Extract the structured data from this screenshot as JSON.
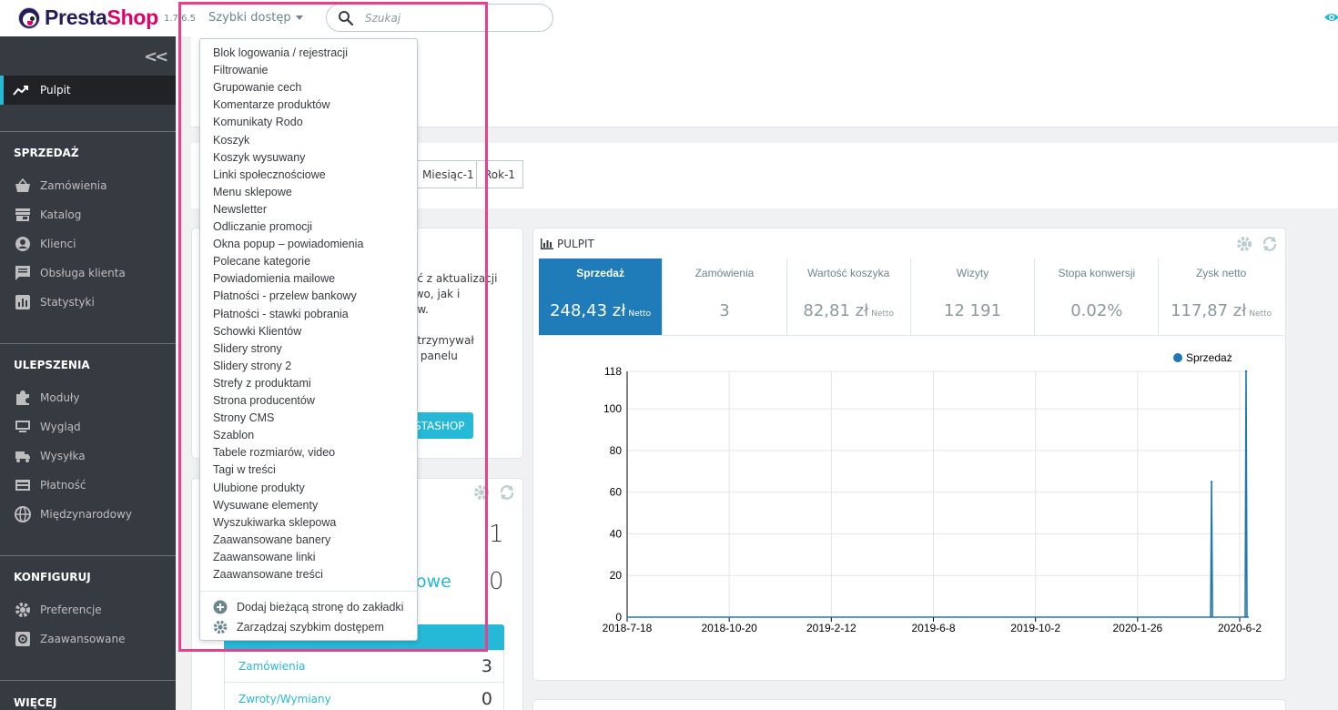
{
  "header": {
    "logo_presta": "Presta",
    "logo_shop": "Shop",
    "version": "1.7.6.5",
    "quick_access_label": "Szybki dostęp",
    "search_placeholder": "Szukaj"
  },
  "sidebar": {
    "collapse_label": "<<",
    "dashboard_label": "Pulpit",
    "sections": [
      {
        "title": "SPRZEDAŻ",
        "items": [
          {
            "label": "Zamówienia",
            "icon": "shopping-basket-icon"
          },
          {
            "label": "Katalog",
            "icon": "store-icon"
          },
          {
            "label": "Klienci",
            "icon": "user-circle-icon"
          },
          {
            "label": "Obsługa klienta",
            "icon": "chat-icon"
          },
          {
            "label": "Statystyki",
            "icon": "bar-chart-icon"
          }
        ]
      },
      {
        "title": "ULEPSZENIA",
        "items": [
          {
            "label": "Moduły",
            "icon": "puzzle-icon"
          },
          {
            "label": "Wygląd",
            "icon": "monitor-icon"
          },
          {
            "label": "Wysyłka",
            "icon": "truck-icon"
          },
          {
            "label": "Płatność",
            "icon": "payment-icon"
          },
          {
            "label": "Międzynarodowy",
            "icon": "globe-icon"
          }
        ]
      },
      {
        "title": "KONFIGURUJ",
        "items": [
          {
            "label": "Preferencje",
            "icon": "settings-icon"
          },
          {
            "label": "Zaawansowane",
            "icon": "settings-box-icon"
          }
        ]
      },
      {
        "title": "WIĘCEJ",
        "items": []
      }
    ]
  },
  "period": {
    "month_label": "Miesiąc-1",
    "year_label": "Rok-1"
  },
  "left_panel": {
    "text_lines": [
      "ać z aktualizacji",
      "two, jak i",
      "ów.",
      "",
      "otrzymywał",
      "y panelu"
    ],
    "button_label": "STASHOP"
  },
  "activity_panel": {
    "big_num_1": "1",
    "big_num_2": "0",
    "blue_text": "owe",
    "rows": [
      {
        "label": "Zamówienia",
        "value": "3"
      },
      {
        "label": "Zwroty/Wymiany",
        "value": "0"
      }
    ]
  },
  "dashboard": {
    "title": "PULPIT",
    "kpis": [
      {
        "label": "Sprzedaż",
        "value": "248,43 zł",
        "suffix": "Netto",
        "active": true
      },
      {
        "label": "Zamówienia",
        "value": "3",
        "suffix": ""
      },
      {
        "label": "Wartość koszyka",
        "value": "82,81 zł",
        "suffix": "Netto"
      },
      {
        "label": "Wizyty",
        "value": "12 191",
        "suffix": ""
      },
      {
        "label": "Stopa konwersji",
        "value": "0.02%",
        "suffix": ""
      },
      {
        "label": "Zysk netto",
        "value": "117,87 zł",
        "suffix": "Netto"
      }
    ]
  },
  "chart_data": {
    "type": "line",
    "title": "",
    "xlabel": "",
    "ylabel": "",
    "x_tick_labels": [
      "2018-7-18",
      "2018-10-20",
      "2019-2-12",
      "2019-6-8",
      "2019-10-2",
      "2020-1-26",
      "2020-6-2"
    ],
    "y_ticks": [
      0,
      20,
      40,
      60,
      80,
      100,
      118
    ],
    "ylim": [
      0,
      118
    ],
    "xlim": [
      "2018-07-18",
      "2020-06-02"
    ],
    "grid": true,
    "legend_position": "top-right",
    "series": [
      {
        "name": "Sprzedaż",
        "color": "#1f77b4",
        "points": [
          {
            "x": "2018-07-18",
            "y": 0
          },
          {
            "x": "2020-04-21",
            "y": 0
          },
          {
            "x": "2020-04-22",
            "y": 65
          },
          {
            "x": "2020-04-23",
            "y": 0
          },
          {
            "x": "2020-05-29",
            "y": 0
          },
          {
            "x": "2020-05-30",
            "y": 118
          },
          {
            "x": "2020-05-31",
            "y": 0
          },
          {
            "x": "2020-06-02",
            "y": 0
          }
        ]
      }
    ]
  },
  "quick_access_menu": {
    "items": [
      "Blok logowania / rejestracji",
      "Filtrowanie",
      "Grupowanie cech",
      "Komentarze produktów",
      "Komunikaty Rodo",
      "Koszyk",
      "Koszyk wysuwany",
      "Linki społecznościowe",
      "Menu sklepowe",
      "Newsletter",
      "Odliczanie promocji",
      "Okna popup – powiadomienia",
      "Polecane kategorie",
      "Powiadomienia mailowe",
      "Płatności - przelew bankowy",
      "Płatności - stawki pobrania",
      "Schowki Klientów",
      "Slidery strony",
      "Slidery strony 2",
      "Strefy z produktami",
      "Strona producentów",
      "Strony CMS",
      "Szablon",
      "Tabele rozmiarów, video",
      "Tagi w treści",
      "Ulubione produkty",
      "Wysuwane elementy",
      "Wyszukiwarka sklepowa",
      "Zaawansowane banery",
      "Zaawansowane linki",
      "Zaawansowane treści"
    ],
    "add_bookmark_label": "Dodaj bieżącą stronę do zakładki",
    "manage_label": "Zarządzaj szybkim dostępem"
  },
  "colors": {
    "accent": "#25b9d7",
    "brand_pink": "#df0067",
    "highlight": "#e8408b",
    "sidebar_bg": "#363a41",
    "kpi_active": "#1f7cb8"
  }
}
